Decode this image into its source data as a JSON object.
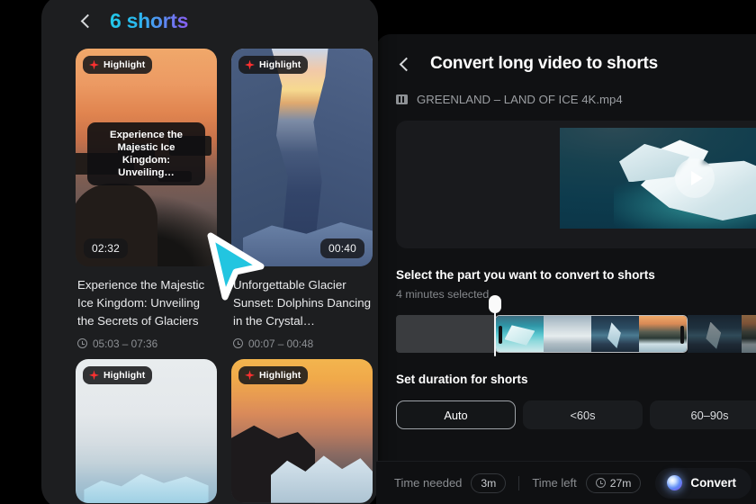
{
  "shorts_panel": {
    "back_icon": "chevron-left-icon",
    "title": "6 shorts",
    "title_gradient_from": "#22c9e8",
    "title_gradient_to": "#8a5cf0",
    "cards": [
      {
        "badge": "Highlight",
        "badge_icon": "sparkle-icon",
        "caption_overlay": "Experience the Majestic Ice Kingdom: Unveiling…",
        "duration": "02:32",
        "title": "Experience the Majestic Ice Kingdom: Unveiling the Secrets of Glaciers",
        "range": "05:03 – 07:36",
        "clock_icon": "clock-icon"
      },
      {
        "badge": "Highlight",
        "badge_icon": "sparkle-icon",
        "duration": "00:40",
        "title": "Unforgettable Glacier Sunset: Dolphins Dancing in the Crystal…",
        "range": "00:07 – 00:48",
        "clock_icon": "clock-icon"
      },
      {
        "badge": "Highlight",
        "badge_icon": "sparkle-icon"
      },
      {
        "badge": "Highlight",
        "badge_icon": "sparkle-icon"
      }
    ]
  },
  "cursor": {
    "icon": "arrow-cursor",
    "color": "#22c5e0"
  },
  "convert_panel": {
    "back_icon": "chevron-left-icon",
    "title": "Convert long video to shorts",
    "file_icon": "film-icon",
    "file_name": "GREENLAND – LAND OF ICE 4K.mp4",
    "preview": {
      "play_icon": "play-icon"
    },
    "select_section": {
      "heading": "Select the part you want to convert to shorts",
      "selected_text": "4 minutes selected",
      "left_handle_icon": "trim-handle-left",
      "right_handle_icon": "trim-handle-right",
      "playhead_icon": "playhead-marker"
    },
    "duration_section": {
      "heading": "Set duration for shorts",
      "options": [
        {
          "label": "Auto",
          "selected": true
        },
        {
          "label": "<60s",
          "selected": false
        },
        {
          "label": "60–90s",
          "selected": false
        }
      ]
    }
  },
  "bottom_bar": {
    "time_needed_label": "Time needed",
    "time_needed_value": "3m",
    "time_left_label": "Time left",
    "time_left_value": "27m",
    "time_left_icon": "clock-icon",
    "convert_label": "Convert",
    "convert_icon": "orb-icon",
    "accent": "#5f8cf5"
  }
}
